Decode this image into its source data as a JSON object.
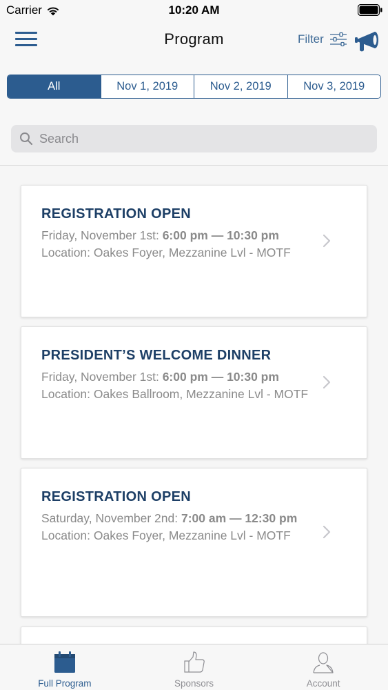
{
  "status_bar": {
    "carrier": "Carrier",
    "time": "10:20 AM"
  },
  "nav": {
    "title": "Program",
    "filter_label": "Filter"
  },
  "segments": [
    "All",
    "Nov 1, 2019",
    "Nov 2, 2019",
    "Nov 3, 2019"
  ],
  "selected_segment": "All",
  "search": {
    "placeholder": "Search",
    "value": ""
  },
  "events": [
    {
      "title": "REGISTRATION OPEN",
      "date": "Friday, November 1st:",
      "time": "6:00 pm — 10:30 pm",
      "location": "Location: Oakes Foyer, Mezzanine Lvl - MOTF"
    },
    {
      "title": "PRESIDENT’S WELCOME DINNER",
      "date": "Friday, November 1st:",
      "time": "6:00 pm — 10:30 pm",
      "location": "Location: Oakes Ballroom, Mezzanine Lvl - MOTF"
    },
    {
      "title": "REGISTRATION OPEN",
      "date": "Saturday, November 2nd:",
      "time": "7:00 am — 12:30 pm",
      "location": "Location: Oakes Foyer, Mezzanine Lvl - MOTF"
    }
  ],
  "tabs": [
    {
      "label": "Full Program",
      "icon": "calendar-icon",
      "active": true
    },
    {
      "label": "Sponsors",
      "icon": "thumbs-up-icon",
      "active": false
    },
    {
      "label": "Account",
      "icon": "person-icon",
      "active": false
    }
  ],
  "colors": {
    "accent": "#2c5c8f",
    "title": "#1d3f66",
    "muted": "#8a8a8a"
  }
}
